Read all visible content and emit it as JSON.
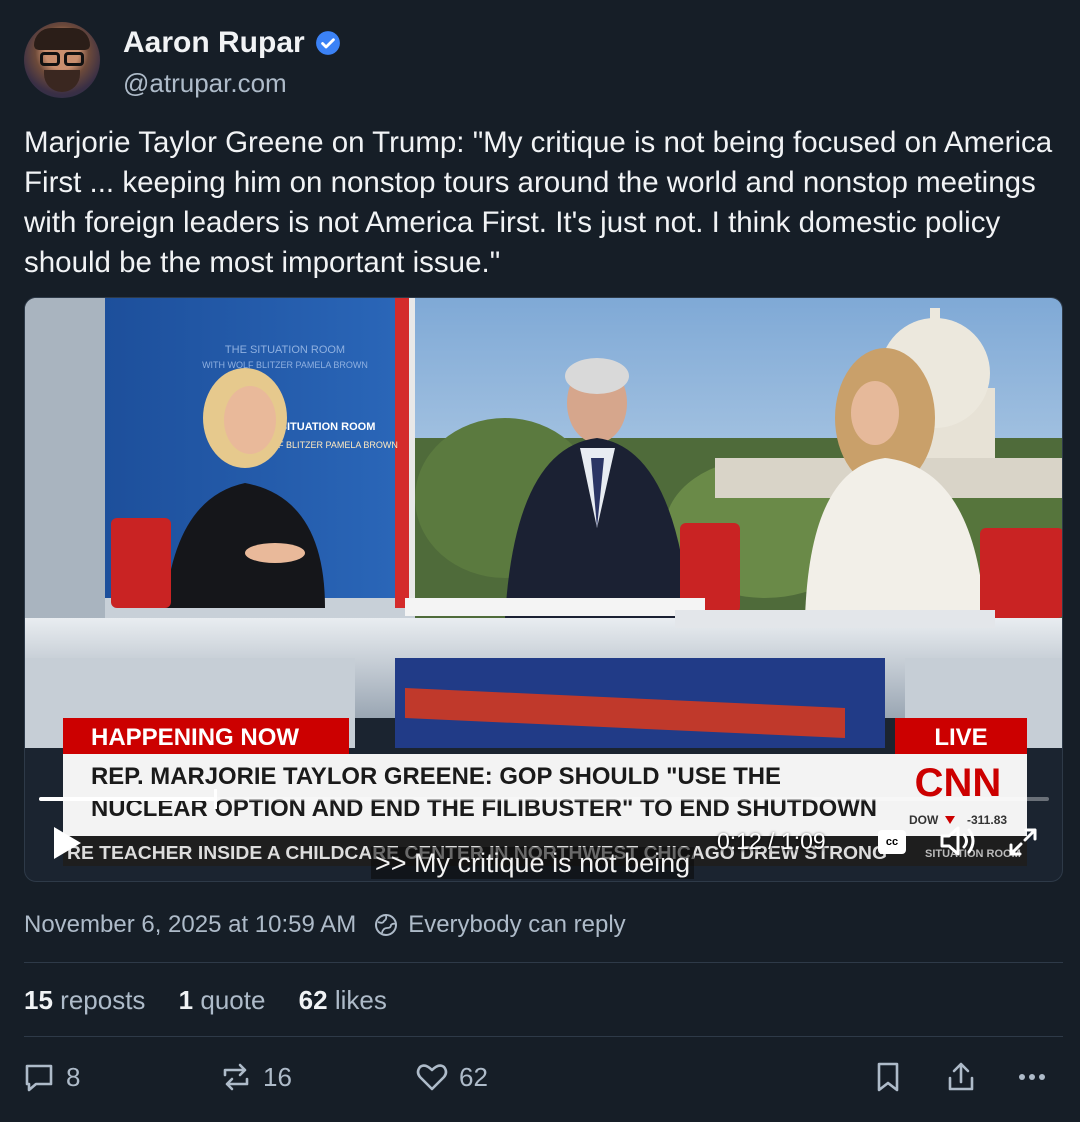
{
  "author": {
    "display_name": "Aaron Rupar",
    "handle": "@atrupar.com",
    "verified": true
  },
  "post": {
    "text": "Marjorie Taylor Greene on Trump: \"My critique is not being focused on America First ... keeping him on nonstop tours around the world and nonstop meetings with foreign leaders is not America First. It's just not. I think domestic policy should be the most important issue.\""
  },
  "video": {
    "time": "0:12 / 1:09",
    "progress": 0.174,
    "caption": ">> My critique is not being",
    "cc_label": "cc",
    "broadcast": {
      "banner_label": "HAPPENING NOW",
      "live_label": "LIVE",
      "headline_line1": "REP. MARJORIE TAYLOR GREENE: GOP SHOULD \"USE THE",
      "headline_line2": "NUCLEAR OPTION AND END THE FILIBUSTER\" TO END SHUTDOWN",
      "ticker": "RE TEACHER INSIDE A CHILDCARE CENTER IN NORTHWEST CHICAGO DREW STRONG",
      "network": "CNN",
      "market_label": "DOW",
      "market_value": "-311.83",
      "ticker_tail": "SITUATION ROOM",
      "wall_title": "THE SITUATION ROOM",
      "wall_with": "WITH WOLF BLITZER PAMELA BROWN"
    }
  },
  "meta": {
    "timestamp": "November 6, 2025 at 10:59 AM",
    "reply_setting": "Everybody can reply"
  },
  "stats": {
    "reposts_count": "15",
    "reposts_label": "reposts",
    "quotes_count": "1",
    "quotes_label": "quote",
    "likes_count": "62",
    "likes_label": "likes"
  },
  "actions": {
    "reply_count": "8",
    "repost_count": "16",
    "like_count": "62"
  },
  "colors": {
    "background": "#161e27",
    "text": "#f1f3f5",
    "muted": "#aebbc9",
    "verified_blue": "#3b82f6",
    "cnn_red": "#cc0000"
  }
}
